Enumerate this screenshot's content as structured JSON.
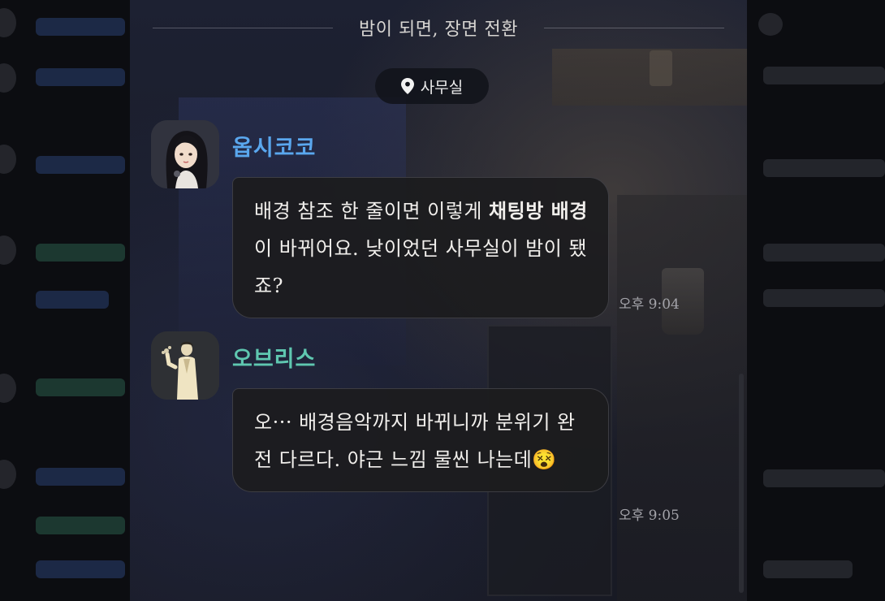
{
  "header": {
    "title": "밤이 되면, 장면 전환"
  },
  "location": {
    "icon": "map-pin-icon",
    "label": "사무실"
  },
  "messages": [
    {
      "sender": "옵시코코",
      "sender_color": "#5aa7ee",
      "avatar": "female-character-avatar",
      "text_parts": [
        {
          "text": "배경 참조 한 줄이면 이렇게 ",
          "bold": false
        },
        {
          "text": "채팅방 배경",
          "bold": true
        },
        {
          "text": "이 바뀌어요. 낮이었던 사무실이 밤이 됐죠?",
          "bold": false
        }
      ],
      "time": "오후 9:04"
    },
    {
      "sender": "오브리스",
      "sender_color": "#5fc7b0",
      "avatar": "male-character-avatar",
      "text_parts": [
        {
          "text": "오··· 배경음악까지 바뀌니까 분위기 완전 다르다. 야근 느낌 물씬 나는데",
          "bold": false
        },
        {
          "text": "😵",
          "bold": false
        }
      ],
      "time": "오후 9:05"
    }
  ]
}
